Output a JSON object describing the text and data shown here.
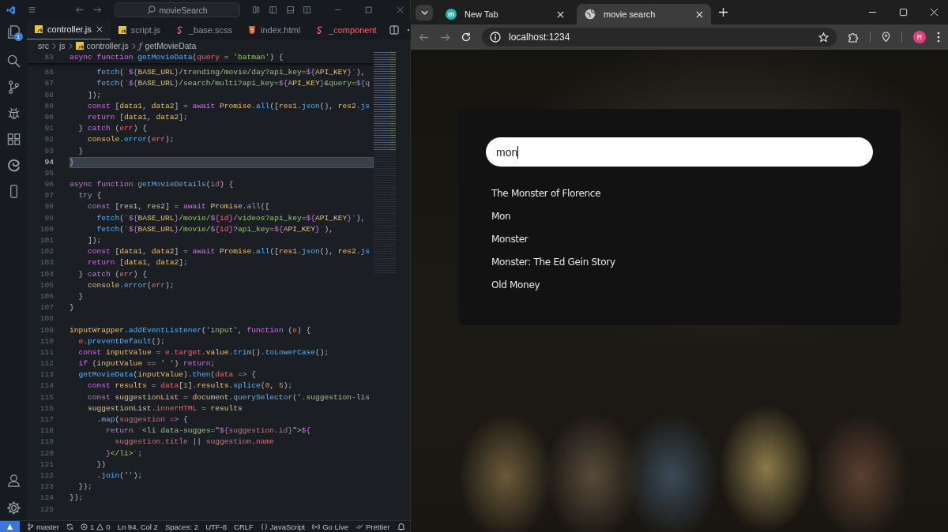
{
  "editor": {
    "command_center": "movieSearch",
    "activity_badge": "1",
    "tabs": [
      {
        "label": "controller.js",
        "kind": "js",
        "selected": true,
        "error": false
      },
      {
        "label": "script.js",
        "kind": "js",
        "selected": false,
        "error": false
      },
      {
        "label": "_base.scss",
        "kind": "scss",
        "selected": false,
        "error": false
      },
      {
        "label": "index.html",
        "kind": "html",
        "selected": false,
        "error": false
      },
      {
        "label": "_component",
        "kind": "scss",
        "selected": false,
        "error": true
      }
    ],
    "breadcrumb": {
      "folders": [
        "src",
        "js"
      ],
      "file": "controller.js",
      "symbol": "ƒ",
      "function": "getMovieData"
    },
    "sticky_line": {
      "number": "83",
      "tokens": [
        {
          "kind": "kw",
          "text": "async function "
        },
        {
          "kind": "fn",
          "text": "getMovieData"
        },
        {
          "kind": "punct",
          "text": "("
        },
        {
          "kind": "param",
          "text": "query"
        },
        {
          "kind": "punct",
          "text": " = "
        },
        {
          "kind": "str",
          "text": "'batman'"
        },
        {
          "kind": "punct",
          "text": ") {"
        }
      ]
    },
    "lines": [
      {
        "number": "86",
        "current": false,
        "tokens": [
          {
            "kind": "fn",
            "text": "      fetch"
          },
          {
            "kind": "punct",
            "text": "("
          },
          {
            "kind": "str",
            "text": "`"
          },
          {
            "kind": "interp",
            "text": "${"
          },
          {
            "kind": "var",
            "text": "BASE_URL"
          },
          {
            "kind": "interp",
            "text": "}"
          },
          {
            "kind": "str",
            "text": "/trending/movie/day?api_key="
          },
          {
            "kind": "interp",
            "text": "${"
          },
          {
            "kind": "var",
            "text": "API_KEY"
          },
          {
            "kind": "interp",
            "text": "}"
          },
          {
            "kind": "str",
            "text": "`"
          },
          {
            "kind": "punct",
            "text": "),"
          }
        ]
      },
      {
        "number": "87",
        "current": false,
        "tokens": [
          {
            "kind": "fn",
            "text": "      fetch"
          },
          {
            "kind": "punct",
            "text": "("
          },
          {
            "kind": "str",
            "text": "`"
          },
          {
            "kind": "interp",
            "text": "${"
          },
          {
            "kind": "var",
            "text": "BASE_URL"
          },
          {
            "kind": "interp",
            "text": "}"
          },
          {
            "kind": "str",
            "text": "/search/multi?api_key="
          },
          {
            "kind": "interp",
            "text": "${"
          },
          {
            "kind": "var",
            "text": "API_KEY"
          },
          {
            "kind": "interp",
            "text": "}"
          },
          {
            "kind": "str",
            "text": "&query="
          },
          {
            "kind": "interp",
            "text": "${q"
          }
        ]
      },
      {
        "number": "88",
        "current": false,
        "tokens": [
          {
            "kind": "punct",
            "text": "    ]);"
          }
        ]
      },
      {
        "number": "89",
        "current": false,
        "tokens": [
          {
            "kind": "kw",
            "text": "    const "
          },
          {
            "kind": "punct",
            "text": "["
          },
          {
            "kind": "var",
            "text": "data1"
          },
          {
            "kind": "punct",
            "text": ", "
          },
          {
            "kind": "var",
            "text": "data2"
          },
          {
            "kind": "punct",
            "text": "] = "
          },
          {
            "kind": "kw",
            "text": "await "
          },
          {
            "kind": "var",
            "text": "Promise"
          },
          {
            "kind": "punct",
            "text": "."
          },
          {
            "kind": "fn",
            "text": "all"
          },
          {
            "kind": "punct",
            "text": "(["
          },
          {
            "kind": "var",
            "text": "res1"
          },
          {
            "kind": "punct",
            "text": "."
          },
          {
            "kind": "fn",
            "text": "json"
          },
          {
            "kind": "punct",
            "text": "(), "
          },
          {
            "kind": "var",
            "text": "res2"
          },
          {
            "kind": "punct",
            "text": "."
          },
          {
            "kind": "fn",
            "text": "js"
          }
        ]
      },
      {
        "number": "90",
        "current": false,
        "tokens": [
          {
            "kind": "kw",
            "text": "    return "
          },
          {
            "kind": "punct",
            "text": "["
          },
          {
            "kind": "var",
            "text": "data1"
          },
          {
            "kind": "punct",
            "text": ", "
          },
          {
            "kind": "var",
            "text": "data2"
          },
          {
            "kind": "punct",
            "text": "];"
          }
        ]
      },
      {
        "number": "91",
        "current": false,
        "tokens": [
          {
            "kind": "punct",
            "text": "  } "
          },
          {
            "kind": "kw",
            "text": "catch "
          },
          {
            "kind": "punct",
            "text": "("
          },
          {
            "kind": "param",
            "text": "err"
          },
          {
            "kind": "punct",
            "text": ") {"
          }
        ]
      },
      {
        "number": "92",
        "current": false,
        "tokens": [
          {
            "kind": "var",
            "text": "    console"
          },
          {
            "kind": "punct",
            "text": "."
          },
          {
            "kind": "fn",
            "text": "error"
          },
          {
            "kind": "punct",
            "text": "("
          },
          {
            "kind": "param",
            "text": "err"
          },
          {
            "kind": "punct",
            "text": ");"
          }
        ]
      },
      {
        "number": "93",
        "current": false,
        "tokens": [
          {
            "kind": "punct",
            "text": "  }"
          }
        ]
      },
      {
        "number": "94",
        "current": true,
        "tokens": [
          {
            "kind": "punct",
            "text": "}"
          }
        ]
      },
      {
        "number": "95",
        "current": false
      },
      {
        "number": "96",
        "current": false,
        "tokens": [
          {
            "kind": "kw",
            "text": "async function "
          },
          {
            "kind": "fn",
            "text": "getMovieDetails"
          },
          {
            "kind": "punct",
            "text": "("
          },
          {
            "kind": "param",
            "text": "id"
          },
          {
            "kind": "punct",
            "text": ") {"
          }
        ]
      },
      {
        "number": "97",
        "current": false,
        "tokens": [
          {
            "kind": "kw",
            "text": "  try "
          },
          {
            "kind": "punct",
            "text": "{"
          }
        ]
      },
      {
        "number": "98",
        "current": false,
        "tokens": [
          {
            "kind": "kw",
            "text": "    const "
          },
          {
            "kind": "punct",
            "text": "["
          },
          {
            "kind": "var",
            "text": "res1"
          },
          {
            "kind": "punct",
            "text": ", "
          },
          {
            "kind": "var",
            "text": "res2"
          },
          {
            "kind": "punct",
            "text": "] = "
          },
          {
            "kind": "kw",
            "text": "await "
          },
          {
            "kind": "var",
            "text": "Promise"
          },
          {
            "kind": "punct",
            "text": "."
          },
          {
            "kind": "fn",
            "text": "all"
          },
          {
            "kind": "punct",
            "text": "(["
          }
        ]
      },
      {
        "number": "99",
        "current": false,
        "tokens": [
          {
            "kind": "fn",
            "text": "      fetch"
          },
          {
            "kind": "punct",
            "text": "("
          },
          {
            "kind": "str",
            "text": "`"
          },
          {
            "kind": "interp",
            "text": "${"
          },
          {
            "kind": "var",
            "text": "BASE_URL"
          },
          {
            "kind": "interp",
            "text": "}"
          },
          {
            "kind": "str",
            "text": "/movie/"
          },
          {
            "kind": "interp",
            "text": "${"
          },
          {
            "kind": "param",
            "text": "id"
          },
          {
            "kind": "interp",
            "text": "}"
          },
          {
            "kind": "str",
            "text": "/videos?api_key="
          },
          {
            "kind": "interp",
            "text": "${"
          },
          {
            "kind": "var",
            "text": "API_KEY"
          },
          {
            "kind": "interp",
            "text": "}"
          },
          {
            "kind": "str",
            "text": "`"
          },
          {
            "kind": "punct",
            "text": "),"
          }
        ]
      },
      {
        "number": "100",
        "current": false,
        "tokens": [
          {
            "kind": "fn",
            "text": "      fetch"
          },
          {
            "kind": "punct",
            "text": "("
          },
          {
            "kind": "str",
            "text": "`"
          },
          {
            "kind": "interp",
            "text": "${"
          },
          {
            "kind": "var",
            "text": "BASE_URL"
          },
          {
            "kind": "interp",
            "text": "}"
          },
          {
            "kind": "str",
            "text": "/movie/"
          },
          {
            "kind": "interp",
            "text": "${"
          },
          {
            "kind": "param",
            "text": "id"
          },
          {
            "kind": "interp",
            "text": "}"
          },
          {
            "kind": "str",
            "text": "?api_key="
          },
          {
            "kind": "interp",
            "text": "${"
          },
          {
            "kind": "var",
            "text": "API_KEY"
          },
          {
            "kind": "interp",
            "text": "}"
          },
          {
            "kind": "str",
            "text": "`"
          },
          {
            "kind": "punct",
            "text": "),"
          }
        ]
      },
      {
        "number": "101",
        "current": false,
        "tokens": [
          {
            "kind": "punct",
            "text": "    ]);"
          }
        ]
      },
      {
        "number": "102",
        "current": false,
        "tokens": [
          {
            "kind": "kw",
            "text": "    const "
          },
          {
            "kind": "punct",
            "text": "["
          },
          {
            "kind": "var",
            "text": "data1"
          },
          {
            "kind": "punct",
            "text": ", "
          },
          {
            "kind": "var",
            "text": "data2"
          },
          {
            "kind": "punct",
            "text": "] = "
          },
          {
            "kind": "kw",
            "text": "await "
          },
          {
            "kind": "var",
            "text": "Promise"
          },
          {
            "kind": "punct",
            "text": "."
          },
          {
            "kind": "fn",
            "text": "all"
          },
          {
            "kind": "punct",
            "text": "(["
          },
          {
            "kind": "var",
            "text": "res1"
          },
          {
            "kind": "punct",
            "text": "."
          },
          {
            "kind": "fn",
            "text": "json"
          },
          {
            "kind": "punct",
            "text": "(), "
          },
          {
            "kind": "var",
            "text": "res2"
          },
          {
            "kind": "punct",
            "text": "."
          },
          {
            "kind": "fn",
            "text": "js"
          }
        ]
      },
      {
        "number": "103",
        "current": false,
        "tokens": [
          {
            "kind": "kw",
            "text": "    return "
          },
          {
            "kind": "punct",
            "text": "["
          },
          {
            "kind": "var",
            "text": "data1"
          },
          {
            "kind": "punct",
            "text": ", "
          },
          {
            "kind": "var",
            "text": "data2"
          },
          {
            "kind": "punct",
            "text": "];"
          }
        ]
      },
      {
        "number": "104",
        "current": false,
        "tokens": [
          {
            "kind": "punct",
            "text": "  } "
          },
          {
            "kind": "kw",
            "text": "catch "
          },
          {
            "kind": "punct",
            "text": "("
          },
          {
            "kind": "param",
            "text": "err"
          },
          {
            "kind": "punct",
            "text": ") {"
          }
        ]
      },
      {
        "number": "105",
        "current": false,
        "tokens": [
          {
            "kind": "var",
            "text": "    console"
          },
          {
            "kind": "punct",
            "text": "."
          },
          {
            "kind": "fn",
            "text": "error"
          },
          {
            "kind": "punct",
            "text": "("
          },
          {
            "kind": "param",
            "text": "err"
          },
          {
            "kind": "punct",
            "text": ");"
          }
        ]
      },
      {
        "number": "106",
        "current": false,
        "tokens": [
          {
            "kind": "punct",
            "text": "  }"
          }
        ]
      },
      {
        "number": "107",
        "current": false,
        "tokens": [
          {
            "kind": "punct",
            "text": "}"
          }
        ]
      },
      {
        "number": "108",
        "current": false
      },
      {
        "number": "109",
        "current": false,
        "tokens": [
          {
            "kind": "var",
            "text": "inputWrapper"
          },
          {
            "kind": "punct",
            "text": "."
          },
          {
            "kind": "fn",
            "text": "addEventListener"
          },
          {
            "kind": "punct",
            "text": "("
          },
          {
            "kind": "str",
            "text": "'input'"
          },
          {
            "kind": "punct",
            "text": ", "
          },
          {
            "kind": "kw",
            "text": "function "
          },
          {
            "kind": "punct",
            "text": "("
          },
          {
            "kind": "param",
            "text": "e"
          },
          {
            "kind": "punct",
            "text": ") {"
          }
        ]
      },
      {
        "number": "110",
        "current": false,
        "tokens": [
          {
            "kind": "param",
            "text": "  e"
          },
          {
            "kind": "punct",
            "text": "."
          },
          {
            "kind": "fn",
            "text": "preventDefault"
          },
          {
            "kind": "punct",
            "text": "();"
          }
        ]
      },
      {
        "number": "111",
        "current": false,
        "tokens": [
          {
            "kind": "kw",
            "text": "  const "
          },
          {
            "kind": "var",
            "text": "inputValue"
          },
          {
            "kind": "punct",
            "text": " = "
          },
          {
            "kind": "param",
            "text": "e"
          },
          {
            "kind": "punct",
            "text": "."
          },
          {
            "kind": "param",
            "text": "target"
          },
          {
            "kind": "punct",
            "text": "."
          },
          {
            "kind": "var",
            "text": "value"
          },
          {
            "kind": "punct",
            "text": "."
          },
          {
            "kind": "fn",
            "text": "trim"
          },
          {
            "kind": "punct",
            "text": "()."
          },
          {
            "kind": "fn",
            "text": "toLowerCase"
          },
          {
            "kind": "punct",
            "text": "();"
          }
        ]
      },
      {
        "number": "112",
        "current": false,
        "tokens": [
          {
            "kind": "kw",
            "text": "  if "
          },
          {
            "kind": "punct",
            "text": "("
          },
          {
            "kind": "var",
            "text": "inputValue"
          },
          {
            "kind": "punct",
            "text": " == "
          },
          {
            "kind": "str",
            "text": "' '"
          },
          {
            "kind": "punct",
            "text": ") "
          },
          {
            "kind": "kw",
            "text": "return"
          },
          {
            "kind": "punct",
            "text": ";"
          }
        ]
      },
      {
        "number": "113",
        "current": false,
        "tokens": [
          {
            "kind": "fn",
            "text": "  getMovieData"
          },
          {
            "kind": "punct",
            "text": "("
          },
          {
            "kind": "var",
            "text": "inputValue"
          },
          {
            "kind": "punct",
            "text": ")."
          },
          {
            "kind": "fn",
            "text": "then"
          },
          {
            "kind": "punct",
            "text": "("
          },
          {
            "kind": "param",
            "text": "data"
          },
          {
            "kind": "kw",
            "text": " => "
          },
          {
            "kind": "punct",
            "text": "{"
          }
        ]
      },
      {
        "number": "114",
        "current": false,
        "tokens": [
          {
            "kind": "kw",
            "text": "    const "
          },
          {
            "kind": "var",
            "text": "results"
          },
          {
            "kind": "punct",
            "text": " = "
          },
          {
            "kind": "param",
            "text": "data"
          },
          {
            "kind": "punct",
            "text": "["
          },
          {
            "kind": "num",
            "text": "1"
          },
          {
            "kind": "punct",
            "text": "]."
          },
          {
            "kind": "var",
            "text": "results"
          },
          {
            "kind": "punct",
            "text": "."
          },
          {
            "kind": "fn",
            "text": "splice"
          },
          {
            "kind": "punct",
            "text": "("
          },
          {
            "kind": "num",
            "text": "0"
          },
          {
            "kind": "punct",
            "text": ", "
          },
          {
            "kind": "num",
            "text": "5"
          },
          {
            "kind": "punct",
            "text": ");"
          }
        ]
      },
      {
        "number": "115",
        "current": false,
        "tokens": [
          {
            "kind": "kw",
            "text": "    const "
          },
          {
            "kind": "var",
            "text": "suggestionList"
          },
          {
            "kind": "punct",
            "text": " = "
          },
          {
            "kind": "var",
            "text": "document"
          },
          {
            "kind": "punct",
            "text": "."
          },
          {
            "kind": "fn",
            "text": "querySelector"
          },
          {
            "kind": "punct",
            "text": "("
          },
          {
            "kind": "str",
            "text": "'.suggestion-lis"
          }
        ]
      },
      {
        "number": "116",
        "current": false,
        "tokens": [
          {
            "kind": "var",
            "text": "    suggestionList"
          },
          {
            "kind": "punct",
            "text": "."
          },
          {
            "kind": "param",
            "text": "innerHTML"
          },
          {
            "kind": "punct",
            "text": " = "
          },
          {
            "kind": "var",
            "text": "results"
          }
        ]
      },
      {
        "number": "117",
        "current": false,
        "tokens": [
          {
            "kind": "punct",
            "text": "      ."
          },
          {
            "kind": "fn",
            "text": "map"
          },
          {
            "kind": "punct",
            "text": "("
          },
          {
            "kind": "param",
            "text": "suggestion"
          },
          {
            "kind": "kw",
            "text": " => "
          },
          {
            "kind": "punct",
            "text": "{"
          }
        ]
      },
      {
        "number": "118",
        "current": false,
        "tokens": [
          {
            "kind": "kw",
            "text": "        return "
          },
          {
            "kind": "str",
            "text": "`<li data-sugges=\""
          },
          {
            "kind": "interp",
            "text": "${"
          },
          {
            "kind": "param",
            "text": "suggestion"
          },
          {
            "kind": "punct",
            "text": "."
          },
          {
            "kind": "param",
            "text": "id"
          },
          {
            "kind": "interp",
            "text": "}"
          },
          {
            "kind": "str",
            "text": "\">"
          },
          {
            "kind": "interp",
            "text": "${"
          }
        ]
      },
      {
        "number": "119",
        "current": false,
        "tokens": [
          {
            "kind": "param",
            "text": "          suggestion"
          },
          {
            "kind": "punct",
            "text": "."
          },
          {
            "kind": "param",
            "text": "title"
          },
          {
            "kind": "punct",
            "text": " || "
          },
          {
            "kind": "param",
            "text": "suggestion"
          },
          {
            "kind": "punct",
            "text": "."
          },
          {
            "kind": "param",
            "text": "name"
          }
        ]
      },
      {
        "number": "120",
        "current": false,
        "tokens": [
          {
            "kind": "interp",
            "text": "        }"
          },
          {
            "kind": "str",
            "text": "</li>`"
          },
          {
            "kind": "punct",
            "text": ";"
          }
        ]
      },
      {
        "number": "121",
        "current": false,
        "tokens": [
          {
            "kind": "punct",
            "text": "      })"
          }
        ]
      },
      {
        "number": "122",
        "current": false,
        "tokens": [
          {
            "kind": "punct",
            "text": "      ."
          },
          {
            "kind": "fn",
            "text": "join"
          },
          {
            "kind": "punct",
            "text": "("
          },
          {
            "kind": "str",
            "text": "''"
          },
          {
            "kind": "punct",
            "text": ");"
          }
        ]
      },
      {
        "number": "123",
        "current": false,
        "tokens": [
          {
            "kind": "punct",
            "text": "  });"
          }
        ]
      },
      {
        "number": "124",
        "current": false,
        "tokens": [
          {
            "kind": "punct",
            "text": "});"
          }
        ]
      },
      {
        "number": "125",
        "current": false
      }
    ],
    "status_bar": {
      "branch": "master",
      "errors": "1",
      "warnings": "0",
      "items": [
        "Ln 94, Col 2",
        "Spaces: 2",
        "UTF-8",
        "CRLF"
      ],
      "language": "JavaScript",
      "go_live": "Go Live",
      "formatter": "Prettier"
    }
  },
  "browser": {
    "tabs": [
      {
        "label": "New Tab",
        "kind": "site",
        "selected": false
      },
      {
        "label": "movie search",
        "kind": "globe",
        "selected": true
      }
    ],
    "url": "localhost:1234",
    "profile_initial": "R",
    "search": {
      "value": "mon"
    },
    "suggestions": [
      "The Monster of Florence",
      "Mon",
      "Monster",
      "Monster: The Ed Gein Story",
      "Old Money"
    ]
  }
}
